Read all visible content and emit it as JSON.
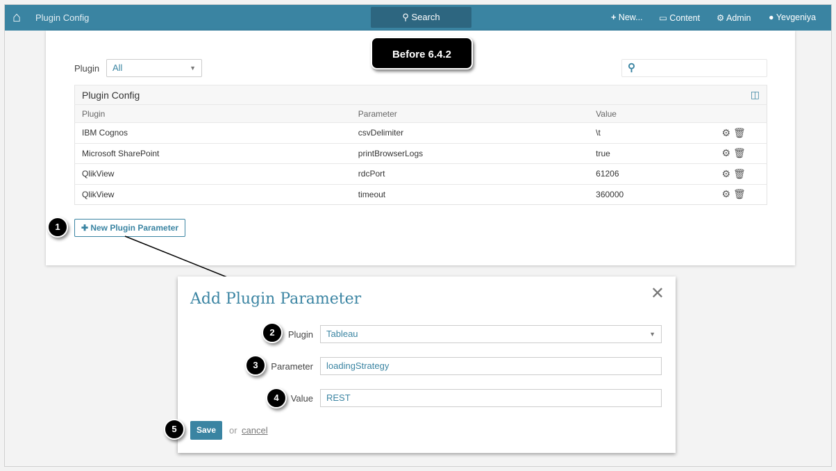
{
  "nav": {
    "title": "Plugin Config",
    "search": "Search",
    "new": "New...",
    "content": "Content",
    "admin": "Admin",
    "user": "Yevgeniya"
  },
  "filter": {
    "label": "Plugin",
    "value": "All"
  },
  "badge": "Before 6.4.2",
  "table": {
    "title": "Plugin Config",
    "columns": [
      "Plugin",
      "Parameter",
      "Value"
    ],
    "rows": [
      [
        "IBM Cognos",
        "csvDelimiter",
        "\\t"
      ],
      [
        "Microsoft SharePoint",
        "printBrowserLogs",
        "true"
      ],
      [
        "QlikView",
        "rdcPort",
        "61206"
      ],
      [
        "QlikView",
        "timeout",
        "360000"
      ]
    ]
  },
  "new_button": "New Plugin Parameter",
  "modal": {
    "title": "Add Plugin Parameter",
    "plugin_label": "Plugin",
    "plugin_value": "Tableau",
    "parameter_label": "Parameter",
    "parameter_value": "loadingStrategy",
    "value_label": "Value",
    "value_value": "REST",
    "save": "Save",
    "or": "or",
    "cancel": "cancel"
  },
  "callouts": [
    "1",
    "2",
    "3",
    "4",
    "5"
  ]
}
